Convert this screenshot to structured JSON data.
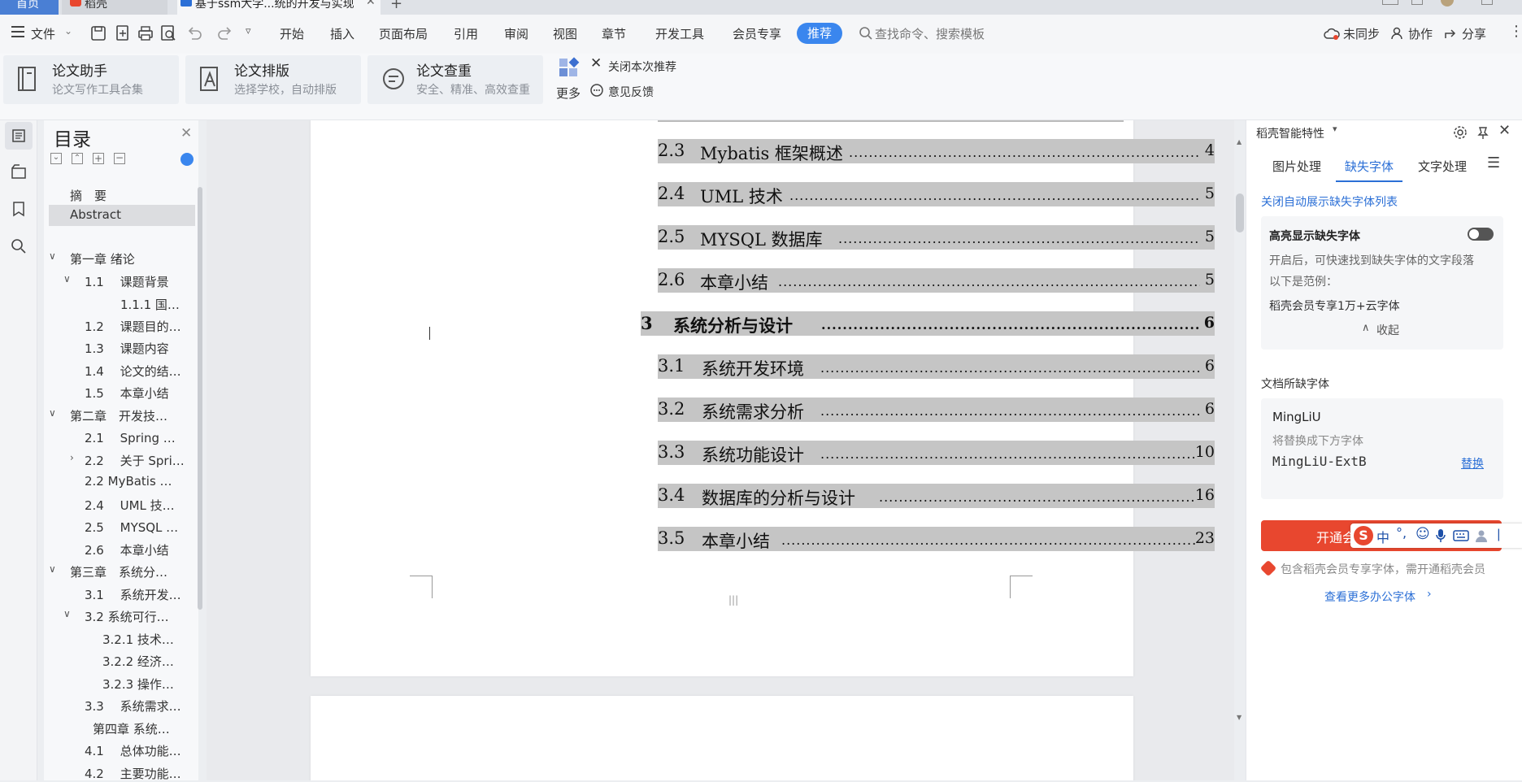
{
  "tabs": [
    {
      "label": "首页"
    },
    {
      "label": "稻壳"
    },
    {
      "label": "基于ssm大学...统的开发与实现"
    }
  ],
  "menu": {
    "file": "文件",
    "items": [
      "开始",
      "插入",
      "页面布局",
      "引用",
      "审阅",
      "视图",
      "章节",
      "开发工具",
      "会员专享"
    ],
    "recommend": "推荐",
    "search_placeholder": "查找命令、搜索模板",
    "right": {
      "sync": "未同步",
      "collab": "协作",
      "share": "分享"
    }
  },
  "ribbon": {
    "cards": [
      {
        "title": "论文助手",
        "sub": "论文写作工具合集"
      },
      {
        "title": "论文排版",
        "sub": "选择学校，自动排版"
      },
      {
        "title": "论文查重",
        "sub": "安全、精准、高效查重"
      }
    ],
    "more": "更多",
    "close_rec": "关闭本次推荐",
    "feedback": "意见反馈"
  },
  "toc": {
    "title": "目录",
    "items": [
      {
        "label": "摘　要"
      },
      {
        "label": "Abstract"
      },
      {
        "label": "第一章  绪论"
      },
      {
        "label": "1.1　 课题背景"
      },
      {
        "label": "1.1.1 国…"
      },
      {
        "label": "1.2　 课题目的…"
      },
      {
        "label": "1.3　 课题内容"
      },
      {
        "label": "1.4　 论文的结…"
      },
      {
        "label": "1.5　 本章小结"
      },
      {
        "label": "第二章　开发技…"
      },
      {
        "label": "2.1　 Spring …"
      },
      {
        "label": "2.2　 关于 Spri…"
      },
      {
        "label": "2.2  MyBatis …"
      },
      {
        "label": "2.4　 UML 技…"
      },
      {
        "label": "2.5　 MYSQL …"
      },
      {
        "label": "2.6　 本章小结"
      },
      {
        "label": "第三章　系统分…"
      },
      {
        "label": "3.1　 系统开发…"
      },
      {
        "label": "3.2 系统可行…"
      },
      {
        "label": "3.2.1 技术…"
      },
      {
        "label": "3.2.2 经济…"
      },
      {
        "label": "3.2.3 操作…"
      },
      {
        "label": "3.3　 系统需求…"
      },
      {
        "label": "第四章  系统…"
      },
      {
        "label": "4.1　 总体功能…"
      },
      {
        "label": "4.2　 主要功能…"
      }
    ]
  },
  "document": {
    "entries": [
      {
        "num": "2.3",
        "text": "Mybatis 框架概述",
        "page": "4"
      },
      {
        "num": "2.4",
        "text": "UML 技术",
        "page": "5"
      },
      {
        "num": "2.5",
        "text": "MYSQL 数据库",
        "page": "5"
      },
      {
        "num": "2.6",
        "text": "本章小结",
        "page": "5"
      },
      {
        "num": "3",
        "text": "系统分析与设计",
        "page": "6"
      },
      {
        "num": "3.1",
        "text": "系统开发环境",
        "page": "6"
      },
      {
        "num": "3.2",
        "text": "系统需求分析",
        "page": "6"
      },
      {
        "num": "3.3",
        "text": "系统功能设计",
        "page": "10"
      },
      {
        "num": "3.4",
        "text": "数据库的分析与设计",
        "page": "16"
      },
      {
        "num": "3.5",
        "text": "本章小结",
        "page": "23"
      }
    ]
  },
  "panel": {
    "title": "稻壳智能特性",
    "tabs": [
      "图片处理",
      "缺失字体",
      "文字处理"
    ],
    "close_link": "关闭自动展示缺失字体列表",
    "highlight_title": "高亮显示缺失字体",
    "desc": "开启后，可快速找到缺失字体的文字段落",
    "example_label": "以下是范例：",
    "example_text": "稻壳会员专享1万+云字体",
    "collapse": "收起",
    "missing_title": "文档所缺字体",
    "font_name": "MingLiU",
    "replace_hint": "将替换成下方字体",
    "replacement": "MingLiU-ExtB",
    "replace_btn": "替换",
    "open_btn": "开通会员",
    "ime": "中",
    "member_note": "包含稻壳会员专享字体，需开通稻壳会员",
    "more_fonts": "查看更多办公字体"
  },
  "colors": {
    "accent": "#2b6fd6",
    "red": "#e8472f",
    "highlight": "#c5c5c5"
  }
}
